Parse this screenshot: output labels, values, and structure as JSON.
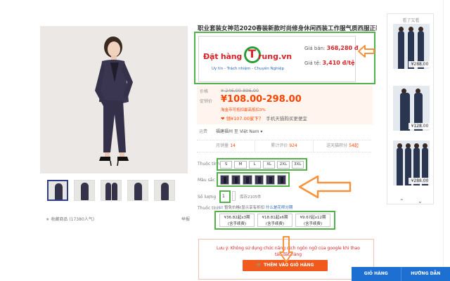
{
  "product": {
    "title": "职业套装女神范2020春装新款时尚修身休闲西装工作服气质西服正装"
  },
  "promo": {
    "logo_dat_hang": "Đặt hàng",
    "logo_t": "T",
    "logo_rung": "rung.vn",
    "slogan": "Uy tín - Trách nhiệm - Chuyên Nghiệp",
    "label_ban": "Giá bán:",
    "value_ban": "368,280 đ",
    "label_te": "Giá tệ:",
    "value_te": "3,410 đ/tệ"
  },
  "price": {
    "label_price": "价格",
    "old_price": "¥ 246.00-896.00",
    "label_promo": "促销价",
    "new_price": "¥108.00-298.00",
    "note": "淘金币可抵扣最高抵扣3%",
    "promo_red": "❤ 领¥107.00家下？",
    "promo_grey": "手机天猫购买更便宜",
    "label_ship": "运费",
    "ship_value": "福建福州  至  Việt Nam ▾"
  },
  "stats": [
    {
      "label": "月销量",
      "value": "14"
    },
    {
      "label": "累计评价",
      "value": "924"
    },
    {
      "label": "送天猫积分",
      "value": "54起"
    }
  ],
  "options": {
    "size_label": "Thuộc tính",
    "sizes": [
      "S",
      "M",
      "L",
      "XL",
      "2XL",
      "3XL"
    ],
    "color_label": "Màu sắc",
    "qty_label": "Số lượng",
    "qty_value": "1",
    "stock": "库存2105件",
    "install_label": "Thuốc tính",
    "install_note_chk": "☑",
    "install_note": "暂免价格t显示享有折扣 ",
    "install_note_link": "什么是花呗分期",
    "installments": [
      {
        "line1": "¥36.82起x3期",
        "line2": "(含手续费)"
      },
      {
        "line1": "¥18.81起x6期",
        "line2": "(含手续费)"
      },
      {
        "line1": "¥9.67起x12期",
        "line2": "(含手续费)"
      }
    ]
  },
  "notice": {
    "text": "Lưu ý: Không sử dụng chức năng dịch ngôn ngữ của google khi thao tác đặt hàng",
    "cart_button": "THÊM VÀO GIỎ HÀNG"
  },
  "gallery": {
    "fav_text": "收藏商品",
    "fav_count": "(17380人气)",
    "report": "举报"
  },
  "recs": {
    "title": "看了又看",
    "prices": [
      "¥288.00",
      "¥128.00",
      "¥288.00"
    ],
    "prev": "⌃",
    "next": "⌄"
  },
  "bottombar": {
    "cart": "GIỎ HÀNG",
    "guide": "HƯỚNG DẪN"
  },
  "colors": {
    "green_frame": "#52b147",
    "orange_arrow": "#f7923a",
    "price_red": "#ff4400",
    "bar_blue": "#1e6fd2"
  }
}
